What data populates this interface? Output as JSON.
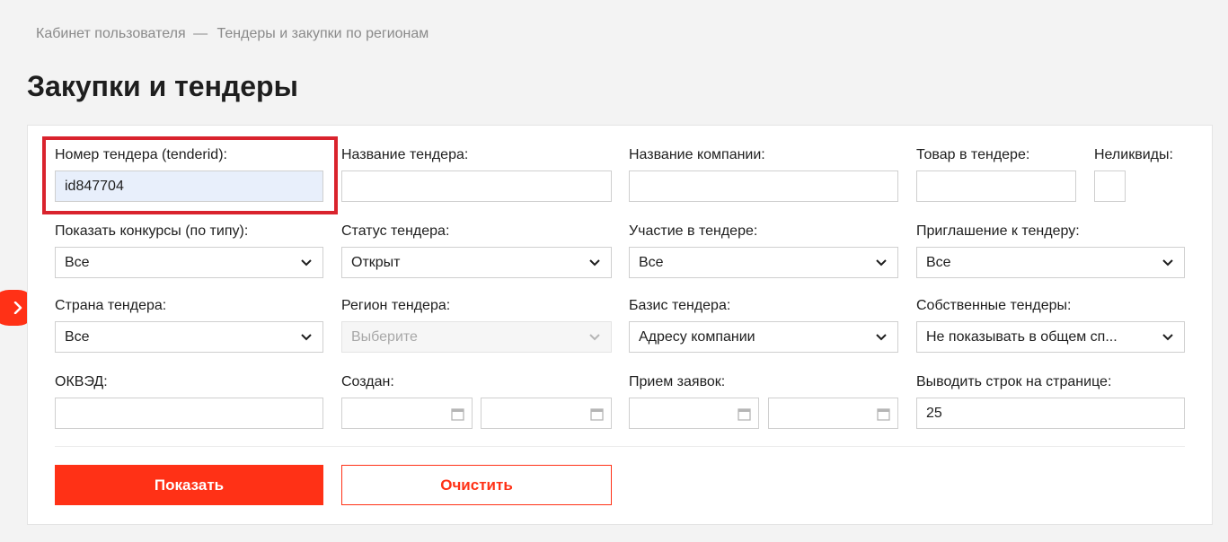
{
  "breadcrumb": {
    "home": "Кабинет пользователя",
    "separator": "—",
    "current": "Тендеры и закупки по регионам"
  },
  "page_title": "Закупки и тендеры",
  "filters": {
    "tender_id": {
      "label": "Номер тендера (tenderid):",
      "value": "id847704"
    },
    "tender_name": {
      "label": "Название тендера:",
      "value": ""
    },
    "company_name": {
      "label": "Название компании:",
      "value": ""
    },
    "product": {
      "label": "Товар в тендере:",
      "value": ""
    },
    "illiquid": {
      "label": "Неликвиды:",
      "value": ""
    },
    "contest_type": {
      "label": "Показать конкурсы (по типу):",
      "value": "Все"
    },
    "status": {
      "label": "Статус тендера:",
      "value": "Открыт"
    },
    "participation": {
      "label": "Участие в тендере:",
      "value": "Все"
    },
    "invitation": {
      "label": "Приглашение к тендеру:",
      "value": "Все"
    },
    "country": {
      "label": "Страна тендера:",
      "value": "Все"
    },
    "region": {
      "label": "Регион тендера:",
      "value": "Выберите"
    },
    "basis": {
      "label": "Базис тендера:",
      "value": "Адресу компании"
    },
    "own_tenders": {
      "label": "Собственные тендеры:",
      "value": "Не показывать в общем сп..."
    },
    "okved": {
      "label": "ОКВЭД:",
      "value": ""
    },
    "created": {
      "label": "Создан:"
    },
    "applications": {
      "label": "Прием заявок:"
    },
    "rows_per_page": {
      "label": "Выводить строк на странице:",
      "value": "25"
    }
  },
  "buttons": {
    "show": "Показать",
    "clear": "Очистить"
  },
  "colors": {
    "accent": "#ff3116",
    "highlight": "#d9232d",
    "filled_input": "#e8effb"
  },
  "icons": {
    "side_toggle": "chevron-right-icon",
    "dropdown": "chevron-down-icon",
    "date": "calendar-icon"
  }
}
